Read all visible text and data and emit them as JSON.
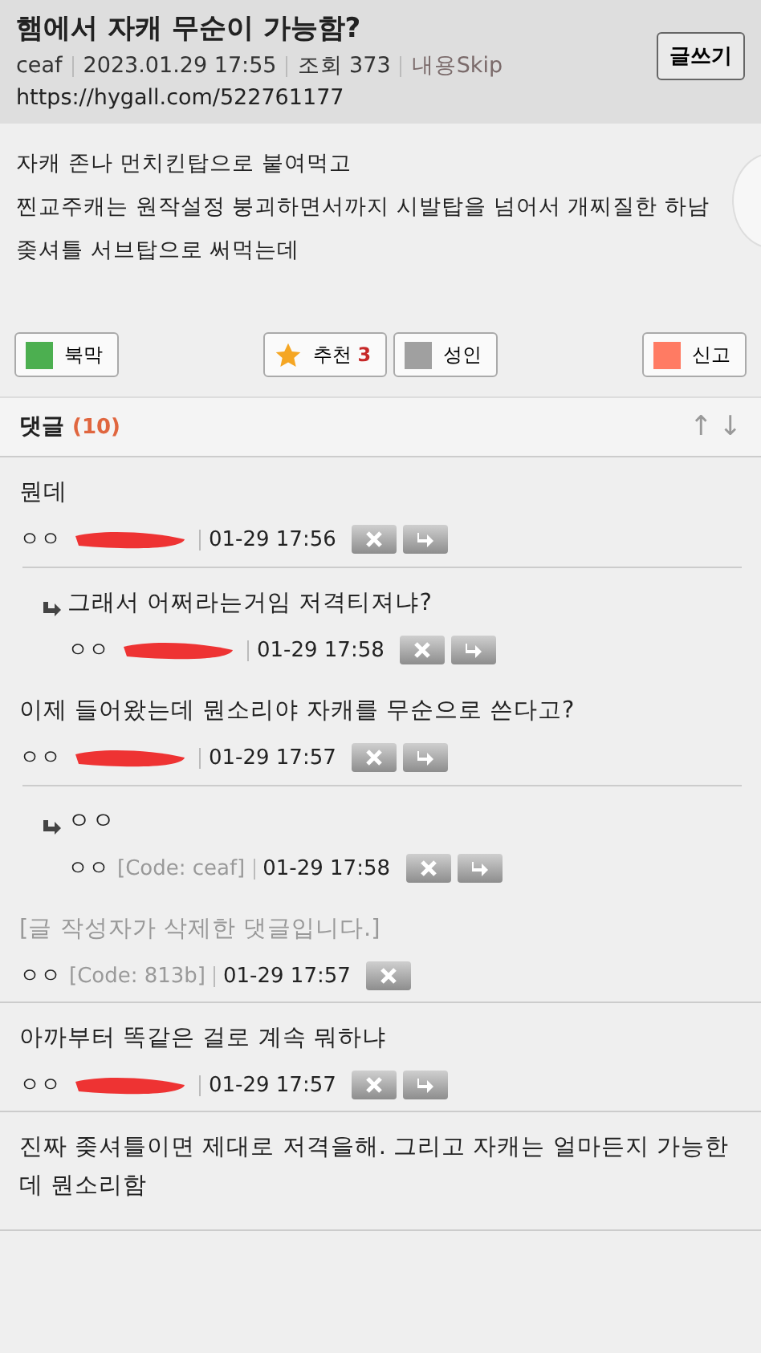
{
  "post": {
    "title": "햄에서 자캐 무순이 가능함?",
    "author": "ceaf",
    "date": "2023.01.29 17:55",
    "views": "조회 373",
    "skip_link": "내용Skip",
    "url": "https://hygall.com/522761177",
    "write_button": "글쓰기",
    "body": [
      "자캐 존나 먼치킨탑으로 붙여먹고",
      "찐교주캐는 원작설정 붕괴하면서까지 시발탑을 넘어서 개찌질한 하남",
      "좆셔틀 서브탑으로 써먹는데"
    ]
  },
  "actions": [
    {
      "label": "북막",
      "color": "#4caf50",
      "kind": "swatch"
    },
    {
      "label": "추천",
      "count": "3",
      "kind": "star"
    },
    {
      "label": "성인",
      "color": "#a0a0a0",
      "kind": "swatch"
    },
    {
      "label": "신고",
      "color": "#ff7b63",
      "kind": "swatch"
    }
  ],
  "comments_header": {
    "title": "댓글",
    "count": "(10)",
    "up": "↑",
    "down": "↓"
  },
  "comments": [
    {
      "kind": "comment",
      "text": "뭔데",
      "author": "ㅇㅇ",
      "redacted": true,
      "time": "01-29 17:56",
      "delete_button": true,
      "reply_button": true
    },
    {
      "kind": "reply",
      "text": "그래서 어쩌라는거임 저격티져냐?",
      "author": "ㅇㅇ",
      "redacted": true,
      "time": "01-29 17:58",
      "delete_button": true,
      "reply_button": true
    },
    {
      "kind": "comment",
      "text": "이제 들어왔는데 뭔소리야 자캐를 무순으로 쓴다고?",
      "author": "ㅇㅇ",
      "redacted": true,
      "time": "01-29 17:57",
      "delete_button": true,
      "reply_button": true
    },
    {
      "kind": "reply",
      "text": "ㅇㅇ",
      "author": "ㅇㅇ",
      "code": "[Code: ceaf]",
      "redacted": false,
      "time": "01-29 17:58",
      "delete_button": true,
      "reply_button": true
    },
    {
      "kind": "deleted",
      "text": "[글 작성자가 삭제한 댓글입니다.]",
      "author": "ㅇㅇ",
      "code": "[Code: 813b]",
      "redacted": false,
      "time": "01-29 17:57",
      "delete_button": true,
      "reply_button": false
    },
    {
      "kind": "comment",
      "text": "아까부터 똑같은 걸로 계속 뭐하냐",
      "author": "ㅇㅇ",
      "redacted": true,
      "time": "01-29 17:57",
      "delete_button": true,
      "reply_button": true
    },
    {
      "kind": "comment",
      "text": "진짜 좆셔틀이면 제대로 저격을해. 그리고 자캐는 얼마든지 가능한데 뭔소리함"
    }
  ]
}
